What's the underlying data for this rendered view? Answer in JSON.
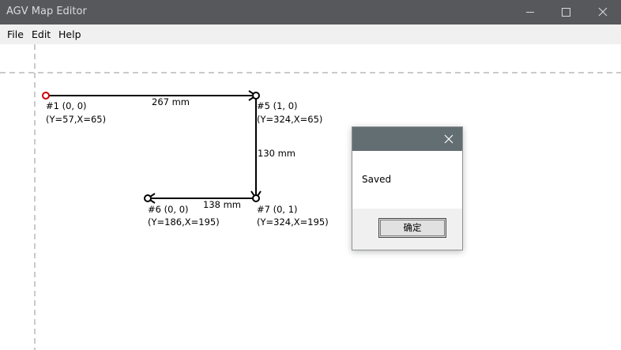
{
  "window": {
    "title": "AGV Map Editor"
  },
  "menu": {
    "items": [
      "File",
      "Edit",
      "Help"
    ]
  },
  "map": {
    "nodes": [
      {
        "id": "#1 (0, 0)",
        "coords": "(Y=57,X=65)",
        "color": "#cc0000"
      },
      {
        "id": "#5 (1, 0)",
        "coords": "(Y=324,X=65)"
      },
      {
        "id": "#6 (0, 0)",
        "coords": "(Y=186,X=195)"
      },
      {
        "id": "#7 (0, 1)",
        "coords": "(Y=324,X=195)"
      }
    ],
    "edges": [
      {
        "label": "267 mm"
      },
      {
        "label": "130 mm"
      },
      {
        "label": "138 mm"
      }
    ]
  },
  "dialog": {
    "message": "Saved",
    "ok_label": "确定"
  }
}
